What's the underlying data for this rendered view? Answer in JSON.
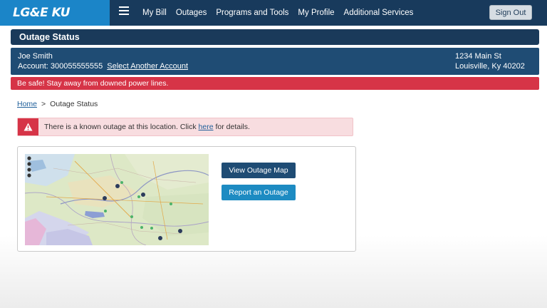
{
  "header": {
    "logo": "LG&E KU",
    "nav": [
      "My Bill",
      "Outages",
      "Programs and Tools",
      "My Profile",
      "Additional Services"
    ],
    "sign_out": "Sign Out"
  },
  "page_title": "Outage Status",
  "account": {
    "name": "Joe Smith",
    "account_label": "Account: 300055555555",
    "select_link": "Select Another Account",
    "address_line1": "1234 Main St",
    "address_line2": "Louisville, Ky 40202"
  },
  "safety_message": "Be safe!  Stay away from downed power lines.",
  "breadcrumb": {
    "home": "Home",
    "separator": ">",
    "current": "Outage Status"
  },
  "alert": {
    "text_before": "There is a known outage at this location. Click ",
    "link": "here",
    "text_after": " for details."
  },
  "buttons": {
    "view_map": "View Outage Map",
    "report": "Report an Outage"
  },
  "colors": {
    "nav_bg": "#183a5c",
    "logo_bg": "#1b85c8",
    "title_bg": "#1a3a5a",
    "account_bg": "#1f4c74",
    "danger": "#d63447",
    "alert_bg": "#f8dde0",
    "link": "#1f5f9a",
    "secondary_button": "#1d8bc2"
  },
  "icons": {
    "menu": "hamburger-menu-icon",
    "warning": "warning-triangle-icon"
  }
}
